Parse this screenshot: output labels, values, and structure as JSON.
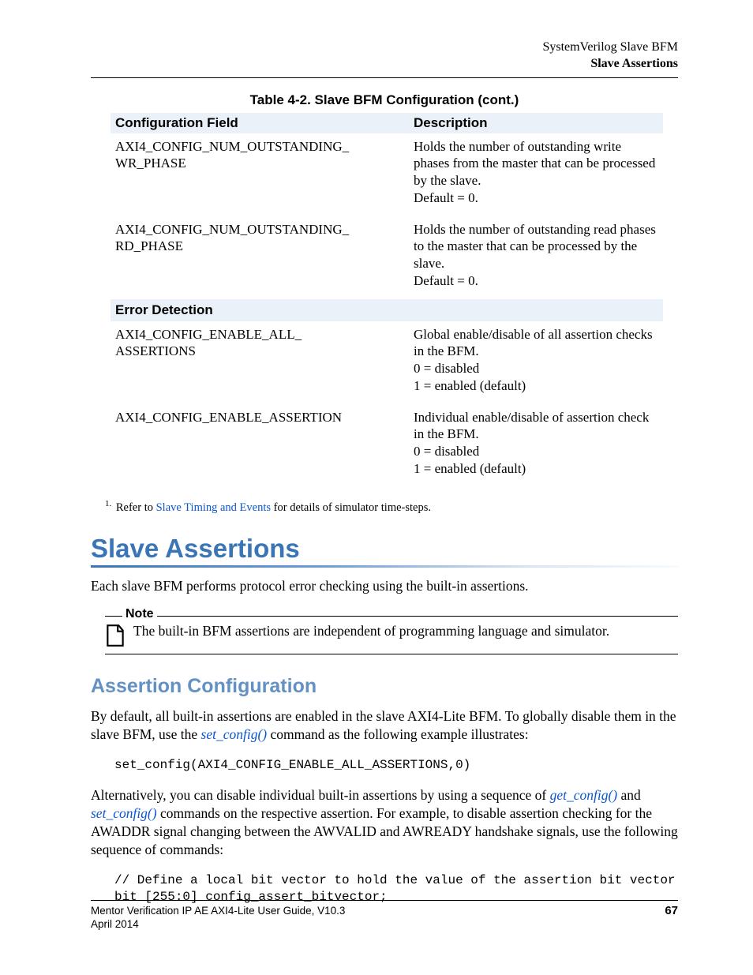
{
  "header": {
    "line1": "SystemVerilog Slave BFM",
    "line2": "Slave Assertions"
  },
  "table": {
    "caption": "Table 4-2. Slave BFM Configuration (cont.)",
    "headers": {
      "c1": "Configuration Field",
      "c2": "Description"
    },
    "rows": [
      {
        "field": "AXI4_CONFIG_NUM_OUTSTANDING_\nWR_PHASE",
        "desc": "Holds the number of outstanding write phases from the master that can be processed by the slave.\nDefault = 0."
      },
      {
        "field": "AXI4_CONFIG_NUM_OUTSTANDING_\nRD_PHASE",
        "desc": "Holds the number of outstanding read phases to the master that can be processed by the slave.\nDefault = 0."
      }
    ],
    "section2": "Error Detection",
    "rows2": [
      {
        "field": "AXI4_CONFIG_ENABLE_ALL_\nASSERTIONS",
        "desc": "Global enable/disable of all assertion checks in the BFM.\n0 = disabled\n1 = enabled (default)"
      },
      {
        "field": "AXI4_CONFIG_ENABLE_ASSERTION",
        "desc": "Individual enable/disable of assertion check in the BFM.\n0 = disabled\n1 = enabled (default)"
      }
    ]
  },
  "footnote": {
    "num": "1.",
    "pre": " Refer to ",
    "link": "Slave Timing and Events",
    "post": " for details of simulator time-steps."
  },
  "h1": "Slave Assertions",
  "intro_p": "Each slave BFM performs protocol error checking using the built-in assertions.",
  "note": {
    "label": "Note",
    "text": "The built-in BFM assertions are independent of programming language and simulator."
  },
  "h2": "Assertion Configuration",
  "p2a": "By default, all built-in assertions are enabled in the slave AXI4-Lite BFM. To globally disable them in the slave BFM, use the ",
  "p2_link1": "set_config()",
  "p2b": " command as the following example illustrates:",
  "code1": "set_config(AXI4_CONFIG_ENABLE_ALL_ASSERTIONS,0)",
  "p3a": "Alternatively, you can disable individual built-in assertions by using a sequence of ",
  "p3_link1": "get_config()",
  "p3b": " and ",
  "p3_link2": "set_config()",
  "p3c": " commands on the respective assertion. For example, to disable assertion checking for the AWADDR signal changing between the AWVALID and AWREADY handshake signals, use the following sequence of commands:",
  "code2": "// Define a local bit vector to hold the value of the assertion bit vector\nbit [255:0] config_assert_bitvector;",
  "footer": {
    "left1": "Mentor Verification IP AE AXI4-Lite User Guide, V10.3",
    "left2": "April 2014",
    "page": "67"
  }
}
